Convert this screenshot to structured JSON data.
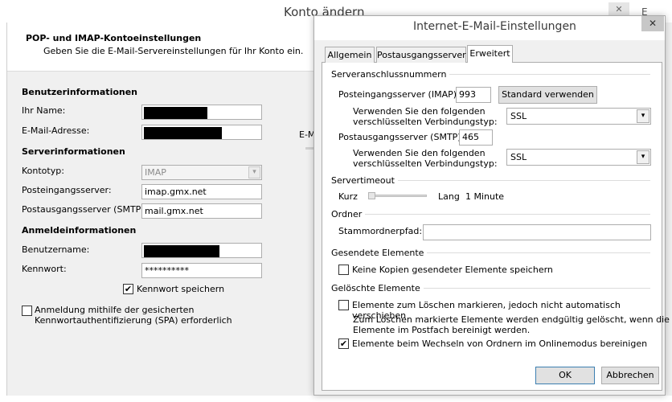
{
  "back_window": {
    "title": "Konto ändern",
    "close_glyph": "✕",
    "right_edge_text": "E",
    "header": {
      "heading": "POP- und IMAP-Kontoeinstellungen",
      "subheading": "Geben Sie die E-Mail-Servereinstellungen für Ihr Konto ein."
    },
    "user_info": {
      "section_title": "Benutzerinformationen",
      "name_label": "Ihr Name:",
      "email_label": "E-Mail-Adresse:"
    },
    "server_info": {
      "section_title": "Serverinformationen",
      "account_type_label": "Kontotyp:",
      "account_type_value": "IMAP",
      "incoming_label": "Posteingangsserver:",
      "incoming_value": "imap.gmx.net",
      "outgoing_label": "Postausgangsserver (SMTP):",
      "outgoing_value": "mail.gmx.net"
    },
    "login_info": {
      "section_title": "Anmeldeinformationen",
      "username_label": "Benutzername:",
      "password_label": "Kennwort:",
      "password_value": "**********",
      "remember_password_label": "Kennwort speichern",
      "remember_password_checked": true,
      "spa_label_line1": "Anmeldung mithilfe der gesicherten",
      "spa_label_line2": "Kennwortauthentifizierung (SPA) erforderlich",
      "spa_checked": false
    },
    "sliver_text": "E-M"
  },
  "dialog": {
    "title": "Internet-E-Mail-Einstellungen",
    "close_glyph": "✕",
    "tabs": [
      {
        "label": "Allgemein",
        "active": false
      },
      {
        "label": "Postausgangsserver",
        "active": false
      },
      {
        "label": "Erweitert",
        "active": true
      }
    ],
    "server_ports": {
      "group_title": "Serveranschlussnummern",
      "imap_label": "Posteingangsserver (IMAP):",
      "imap_value": "993",
      "default_button": "Standard verwenden",
      "enc_label_line1": "Verwenden Sie den folgenden",
      "enc_label_line2": "verschlüsselten Verbindungstyp:",
      "imap_encryption": "SSL",
      "smtp_label": "Postausgangsserver (SMTP):",
      "smtp_value": "465",
      "smtp_encryption": "SSL"
    },
    "timeout": {
      "group_title": "Servertimeout",
      "short_label": "Kurz",
      "long_label": "Lang",
      "value_text": "1 Minute",
      "slider_position": 0.0
    },
    "folder": {
      "group_title": "Ordner",
      "root_path_label": "Stammordnerpfad:",
      "root_path_value": ""
    },
    "sent_items": {
      "group_title": "Gesendete Elemente",
      "no_copies_label": "Keine Kopien gesendeter Elemente speichern",
      "no_copies_checked": false
    },
    "deleted_items": {
      "group_title": "Gelöschte Elemente",
      "mark_label": "Elemente zum Löschen markieren, jedoch nicht automatisch verschieben",
      "mark_checked": false,
      "note_line1": "Zum Löschen markierte Elemente werden endgültig gelöscht, wenn die",
      "note_line2": "Elemente im Postfach bereinigt werden.",
      "purge_label": "Elemente beim Wechseln von Ordnern im Onlinemodus bereinigen",
      "purge_checked": true
    },
    "buttons": {
      "ok": "OK",
      "cancel": "Abbrechen"
    }
  },
  "icons": {
    "dropdown_arrow": "▾",
    "checkmark": "✔"
  }
}
